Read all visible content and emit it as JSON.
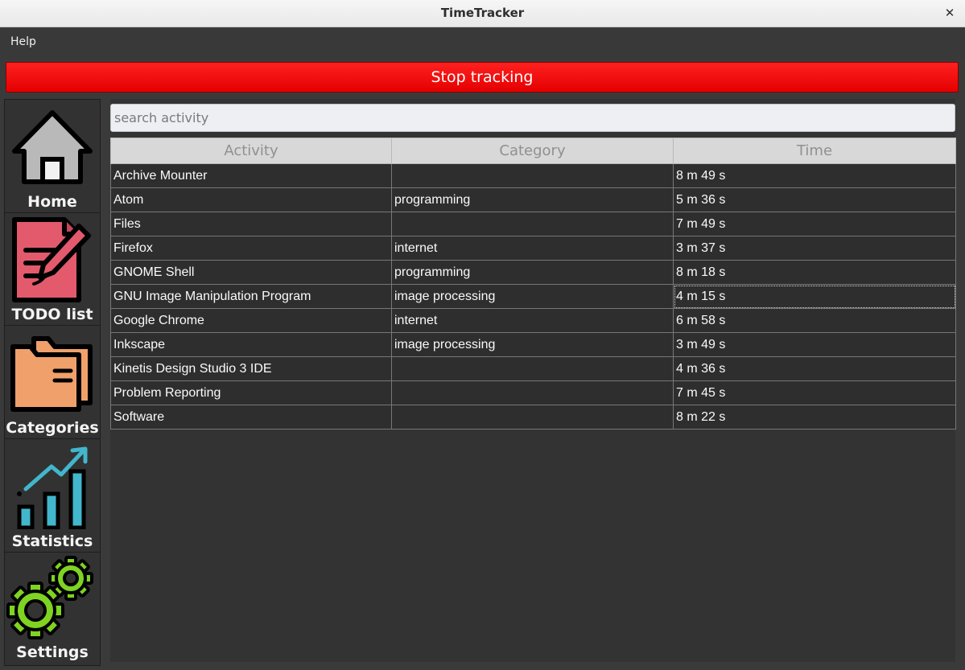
{
  "window": {
    "title": "TimeTracker",
    "close_glyph": "✕"
  },
  "menu": {
    "help_label": "Help"
  },
  "toolbar": {
    "stop_label": "Stop tracking",
    "stop_color": "#f20000"
  },
  "sidebar": {
    "items": [
      {
        "label": "Home",
        "icon": "home-icon"
      },
      {
        "label": "TODO list",
        "icon": "todo-list-icon"
      },
      {
        "label": "Categories",
        "icon": "folder-icon"
      },
      {
        "label": "Statistics",
        "icon": "statistics-icon"
      },
      {
        "label": "Settings",
        "icon": "gear-icon"
      }
    ]
  },
  "search": {
    "placeholder": "search activity",
    "value": ""
  },
  "table": {
    "columns": [
      "Activity",
      "Category",
      "Time"
    ],
    "rows": [
      {
        "activity": "Archive Mounter",
        "category": "",
        "time": "8 m 49 s"
      },
      {
        "activity": "Atom",
        "category": "programming",
        "time": "5 m 36 s"
      },
      {
        "activity": "Files",
        "category": "",
        "time": "7 m 49 s"
      },
      {
        "activity": "Firefox",
        "category": "internet",
        "time": "3 m 37 s"
      },
      {
        "activity": "GNOME Shell",
        "category": "programming",
        "time": "8 m 18 s"
      },
      {
        "activity": "GNU Image Manipulation Program",
        "category": "image processing",
        "time": "4 m 15 s"
      },
      {
        "activity": "Google Chrome",
        "category": "internet",
        "time": "6 m 58 s"
      },
      {
        "activity": "Inkscape",
        "category": "image processing",
        "time": "3 m 49 s"
      },
      {
        "activity": "Kinetis Design Studio 3 IDE",
        "category": "",
        "time": "4 m 36 s"
      },
      {
        "activity": "Problem Reporting",
        "category": "",
        "time": "7 m 45 s"
      },
      {
        "activity": "Software",
        "category": "",
        "time": "8 m 22 s"
      }
    ]
  }
}
